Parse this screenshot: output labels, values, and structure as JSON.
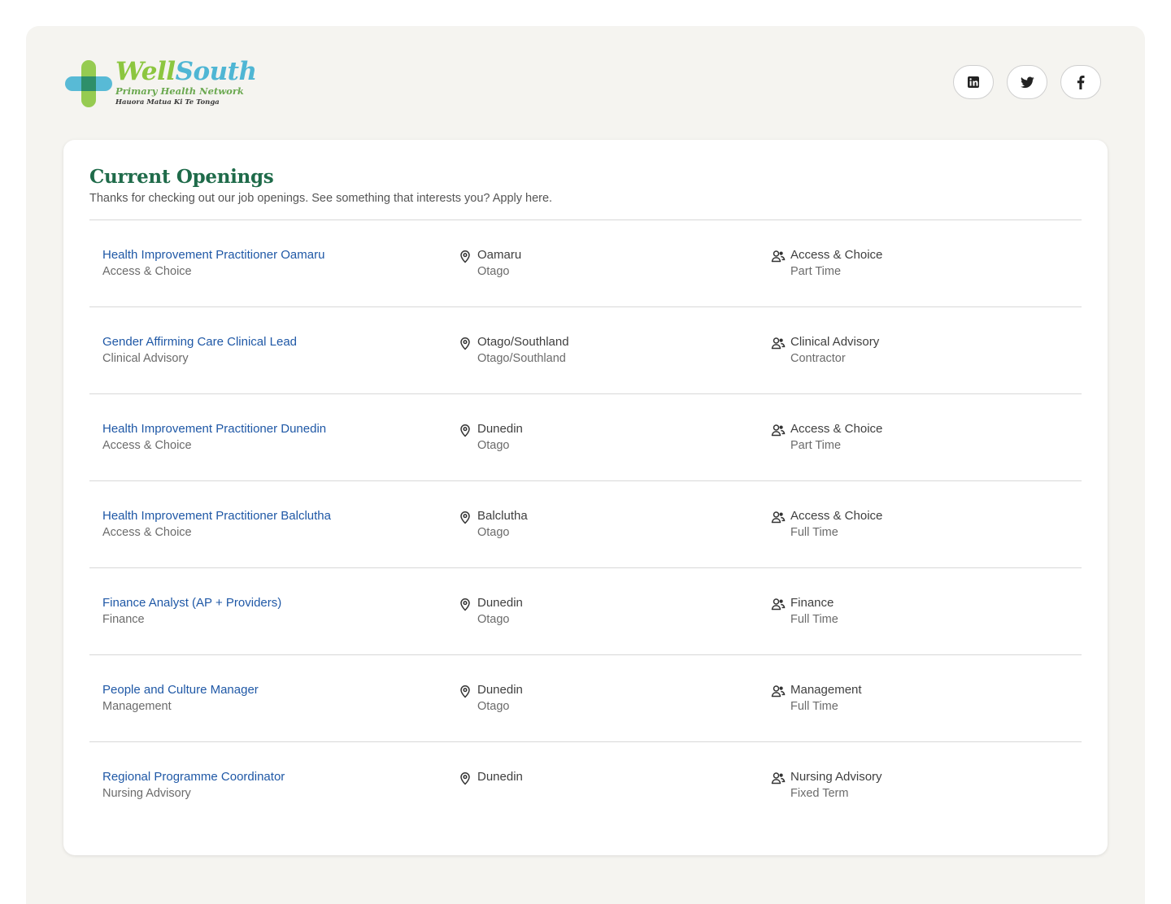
{
  "brand": {
    "word1": "Well",
    "word2": "South",
    "subtitle": "Primary Health Network",
    "tagline": "Hauora Matua Ki Te Tonga"
  },
  "social": [
    {
      "name": "linkedin",
      "icon": "linkedin-icon"
    },
    {
      "name": "twitter",
      "icon": "twitter-icon"
    },
    {
      "name": "facebook",
      "icon": "facebook-icon"
    }
  ],
  "openings": {
    "title": "Current Openings",
    "subtitle": "Thanks for checking out our job openings. See something that interests you? Apply here.",
    "jobs": [
      {
        "title": "Health Improvement Practitioner Oamaru",
        "department": "Access & Choice",
        "location": "Oamaru",
        "region": "Otago",
        "team": "Access & Choice",
        "type": "Part Time"
      },
      {
        "title": "Gender Affirming Care Clinical Lead",
        "department": "Clinical Advisory",
        "location": "Otago/Southland",
        "region": "Otago/Southland",
        "team": "Clinical Advisory",
        "type": "Contractor"
      },
      {
        "title": "Health Improvement Practitioner Dunedin",
        "department": "Access & Choice",
        "location": "Dunedin",
        "region": "Otago",
        "team": "Access & Choice",
        "type": "Part Time"
      },
      {
        "title": "Health Improvement Practitioner Balclutha",
        "department": "Access & Choice",
        "location": "Balclutha",
        "region": "Otago",
        "team": "Access & Choice",
        "type": "Full Time"
      },
      {
        "title": "Finance Analyst (AP + Providers)",
        "department": "Finance",
        "location": "Dunedin",
        "region": "Otago",
        "team": "Finance",
        "type": "Full Time"
      },
      {
        "title": "People and Culture Manager",
        "department": "Management",
        "location": "Dunedin",
        "region": "Otago",
        "team": "Management",
        "type": "Full Time"
      },
      {
        "title": "Regional Programme Coordinator",
        "department": "Nursing Advisory",
        "location": "Dunedin",
        "region": "",
        "team": "Nursing Advisory",
        "type": "Fixed Term"
      }
    ]
  },
  "colors": {
    "accent_green": "#1f6b4a",
    "link_blue": "#1f58a6",
    "brand_lime": "#8cc63f",
    "brand_teal": "#4fb6d4",
    "page_bg": "#f5f4f0"
  }
}
